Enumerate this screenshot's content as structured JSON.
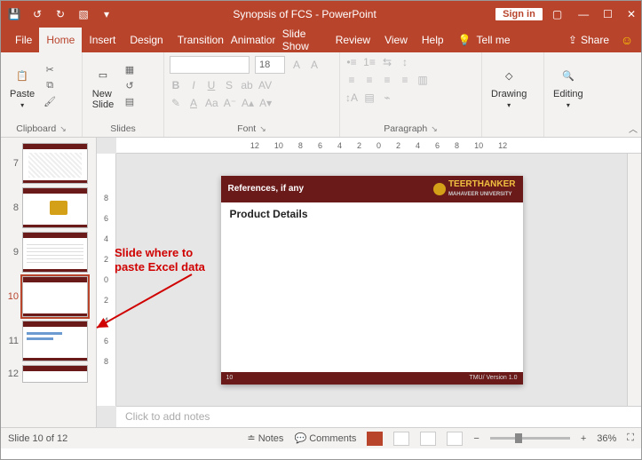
{
  "window": {
    "title": "Synopsis of FCS  -  PowerPoint",
    "sign_in": "Sign in"
  },
  "tabs": {
    "file": "File",
    "home": "Home",
    "insert": "Insert",
    "design": "Design",
    "transitions": "Transitions",
    "animations": "Animations",
    "slideshow": "Slide Show",
    "review": "Review",
    "view": "View",
    "help": "Help",
    "tellme": "Tell me",
    "share": "Share"
  },
  "ribbon": {
    "paste": "Paste",
    "clipboard": "Clipboard",
    "newslide": "New\nSlide",
    "slides": "Slides",
    "font_name_placeholder": " ",
    "font_size": "18",
    "font": "Font",
    "paragraph": "Paragraph",
    "drawing": "Drawing",
    "editing": "Editing"
  },
  "ruler": {
    "h": [
      "12",
      "10",
      "8",
      "6",
      "4",
      "2",
      "0",
      "2",
      "4",
      "6",
      "8",
      "10",
      "12"
    ],
    "v": [
      "8",
      "6",
      "4",
      "2",
      "0",
      "2",
      "4",
      "6",
      "8"
    ]
  },
  "thumbs": [
    {
      "n": "7"
    },
    {
      "n": "8"
    },
    {
      "n": "9"
    },
    {
      "n": "10"
    },
    {
      "n": "11"
    },
    {
      "n": "12"
    }
  ],
  "slide": {
    "header_title": "References, if any",
    "uni_name": "TEERTHANKER",
    "uni_sub": "MAHAVEER UNIVERSITY",
    "body_title": "Product Details",
    "footer_num": "10",
    "footer_ver": "TMU/ Version 1.0"
  },
  "notes": {
    "placeholder": "Click to add notes"
  },
  "status": {
    "slide_of": "Slide 10 of 12",
    "notes": "Notes",
    "comments": "Comments",
    "zoom": "36%"
  },
  "annotation": {
    "line1": "Slide where to",
    "line2": "paste Excel data"
  }
}
